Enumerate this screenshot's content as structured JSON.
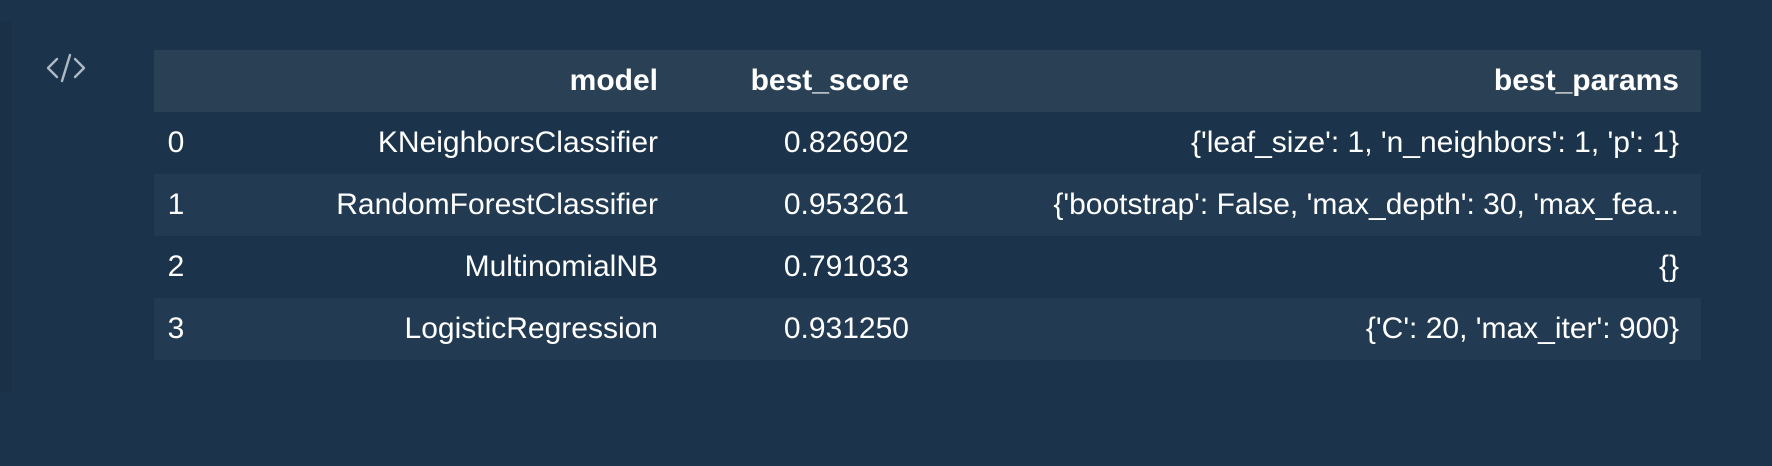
{
  "table": {
    "columns": [
      {
        "key": "index",
        "label": ""
      },
      {
        "key": "model",
        "label": "model"
      },
      {
        "key": "best_score",
        "label": "best_score"
      },
      {
        "key": "best_params",
        "label": "best_params"
      }
    ],
    "rows": [
      {
        "index": "0",
        "model": "KNeighborsClassifier",
        "best_score": "0.826902",
        "best_params": "{'leaf_size': 1, 'n_neighbors': 1, 'p': 1}"
      },
      {
        "index": "1",
        "model": "RandomForestClassifier",
        "best_score": "0.953261",
        "best_params": "{'bootstrap': False, 'max_depth': 30, 'max_fea..."
      },
      {
        "index": "2",
        "model": "MultinomialNB",
        "best_score": "0.791033",
        "best_params": "{}"
      },
      {
        "index": "3",
        "model": "LogisticRegression",
        "best_score": "0.931250",
        "best_params": "{'C': 20, 'max_iter': 900}"
      }
    ]
  },
  "icons": {
    "code_toggle": "code-brackets-icon"
  },
  "colors": {
    "background": "#1b344b",
    "header_background": "#2a4155",
    "alt_row_background": "#223b52",
    "text": "#ffffff",
    "icon": "#aeb9c3"
  }
}
